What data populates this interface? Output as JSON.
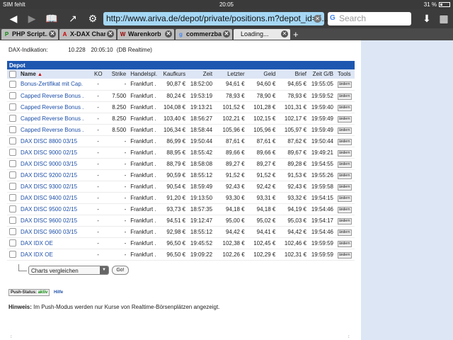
{
  "status": {
    "carrier": "SIM fehlt",
    "time": "20:05",
    "battery": "31 %"
  },
  "browser": {
    "url": "http://www.ariva.de/depot/private/positions.m?depot_id=5...",
    "search_placeholder": "Search"
  },
  "tabs": [
    {
      "label": "PHP Script...",
      "icon": "P"
    },
    {
      "label": "X-DAX Char...",
      "icon": "A"
    },
    {
      "label": "Warenkorb",
      "icon": "W"
    },
    {
      "label": "commerzba...",
      "icon": "g"
    },
    {
      "label": "Loading...",
      "icon": ""
    }
  ],
  "dax": {
    "label": "DAX-Indikation:",
    "value": "10.228",
    "time": "20:05:10",
    "note": "(DB Realtime)"
  },
  "depot": {
    "title": "Depot",
    "headers": [
      "Name",
      "KO",
      "Strike",
      "Handelspl.",
      "Kaufkurs",
      "Zeit",
      "Letzter",
      "Geld",
      "Brief",
      "Zeit G/B",
      "Tools"
    ],
    "tool_label": "ändern",
    "rows": [
      [
        "Bonus-Zertifikat mit Cap.",
        "-",
        "-",
        "Frankfurt .",
        "90,87 €",
        "18:52:00",
        "94,61 €",
        "94,60 €",
        "94,65 €",
        "19:55:05"
      ],
      [
        "Capped Reverse Bonus .",
        "-",
        "7.500",
        "Frankfurt .",
        "80,24 €",
        "19:53:19",
        "78,93 €",
        "78,90 €",
        "78,93 €",
        "19:59:52"
      ],
      [
        "Capped Reverse Bonus .",
        "-",
        "8.250",
        "Frankfurt .",
        "104,08 €",
        "19:13:21",
        "101,52 €",
        "101,28 €",
        "101,31 €",
        "19:59:40"
      ],
      [
        "Capped Reverse Bonus .",
        "-",
        "8.250",
        "Frankfurt .",
        "103,40 €",
        "18:56:27",
        "102,21 €",
        "102,15 €",
        "102,17 €",
        "19:59:49"
      ],
      [
        "Capped Reverse Bonus .",
        "-",
        "8.500",
        "Frankfurt .",
        "106,34 €",
        "18:58:44",
        "105,96 €",
        "105,96 €",
        "105,97 €",
        "19:59:49"
      ],
      [
        "DAX DISC 8800 03/15",
        "-",
        "-",
        "Frankfurt .",
        "86,99 €",
        "19:50:44",
        "87,61 €",
        "87,61 €",
        "87,62 €",
        "19:50:44"
      ],
      [
        "DAX DISC 9000 02/15",
        "-",
        "-",
        "Frankfurt .",
        "88,95 €",
        "18:55:42",
        "89,66 €",
        "89,66 €",
        "89,67 €",
        "19:49:21"
      ],
      [
        "DAX DISC 9000 03/15",
        "-",
        "-",
        "Frankfurt .",
        "88,79 €",
        "18:58:08",
        "89,27 €",
        "89,27 €",
        "89,28 €",
        "19:54:55"
      ],
      [
        "DAX DISC 9200 02/15",
        "-",
        "-",
        "Frankfurt .",
        "90,59 €",
        "18:55:12",
        "91,52 €",
        "91,52 €",
        "91,53 €",
        "19:55:26"
      ],
      [
        "DAX DISC 9300 02/15",
        "-",
        "-",
        "Frankfurt .",
        "90,54 €",
        "18:59:49",
        "92,43 €",
        "92,42 €",
        "92,43 €",
        "19:59:58"
      ],
      [
        "DAX DISC 9400 02/15",
        "-",
        "-",
        "Frankfurt .",
        "91,20 €",
        "19:13:50",
        "93,30 €",
        "93,31 €",
        "93,32 €",
        "19:54:15"
      ],
      [
        "DAX DISC 9500 02/15",
        "-",
        "-",
        "Frankfurt .",
        "93,73 €",
        "18:57:35",
        "94,18 €",
        "94,18 €",
        "94,19 €",
        "19:54:46"
      ],
      [
        "DAX DISC 9600 02/15",
        "-",
        "-",
        "Frankfurt .",
        "94,51 €",
        "19:12:47",
        "95,00 €",
        "95,02 €",
        "95,03 €",
        "19:54:17"
      ],
      [
        "DAX DISC 9600 03/15",
        "-",
        "-",
        "Frankfurt .",
        "92,98 €",
        "18:55:12",
        "94,42 €",
        "94,41 €",
        "94,42 €",
        "19:54:46"
      ],
      [
        "DAX IDX OE",
        "-",
        "-",
        "Frankfurt .",
        "96,50 €",
        "19:45:52",
        "102,38 €",
        "102,45 €",
        "102,46 €",
        "19:59:59"
      ],
      [
        "DAX IDX OE",
        "-",
        "-",
        "Frankfurt .",
        "96,50 €",
        "19:09:22",
        "102,26 €",
        "102,29 €",
        "102,31 €",
        "19:59:59"
      ]
    ]
  },
  "compare": {
    "selected": "Charts vergleichen",
    "go_label": "Go!"
  },
  "push": {
    "label": "Push-Status:",
    "value": "aktiv",
    "help": "Hilfe"
  },
  "hint": {
    "bold": "Hinweis:",
    "text": "Im Push-Modus werden nur Kurse von Realtime-Börsenplätzen angezeigt."
  }
}
